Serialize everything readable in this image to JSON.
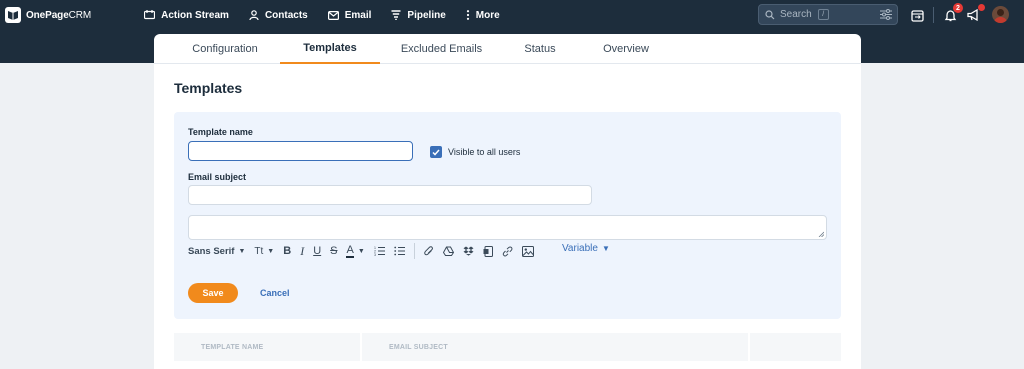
{
  "brand": {
    "bold": "OnePage",
    "thin": "CRM"
  },
  "nav": {
    "items": [
      {
        "label": "Action Stream",
        "icon": "action-stream-icon"
      },
      {
        "label": "Contacts",
        "icon": "contacts-icon"
      },
      {
        "label": "Email",
        "icon": "email-icon"
      },
      {
        "label": "Pipeline",
        "icon": "pipeline-icon"
      },
      {
        "label": "More",
        "icon": "more-icon"
      }
    ]
  },
  "search": {
    "placeholder": "Search",
    "shortcut": "/"
  },
  "notifications": {
    "count": "2"
  },
  "tabs": [
    {
      "label": "Configuration"
    },
    {
      "label": "Templates",
      "active": true
    },
    {
      "label": "Excluded Emails"
    },
    {
      "label": "Status"
    },
    {
      "label": "Overview"
    }
  ],
  "page": {
    "title": "Templates"
  },
  "form": {
    "template_name_label": "Template name",
    "template_name_value": "",
    "visible_label": "Visible to all users",
    "visible_checked": true,
    "subject_label": "Email subject",
    "subject_value": "",
    "body_value": "",
    "font_label": "Sans Serif",
    "size_label": "Tt",
    "variable_label": "Variable",
    "save_label": "Save",
    "cancel_label": "Cancel"
  },
  "table": {
    "columns": [
      "TEMPLATE NAME",
      "EMAIL SUBJECT"
    ]
  },
  "colors": {
    "accent": "#f18a1c",
    "nav_bg": "#1d2d3c",
    "link": "#3a6fb8",
    "panel": "#eef4fd"
  }
}
